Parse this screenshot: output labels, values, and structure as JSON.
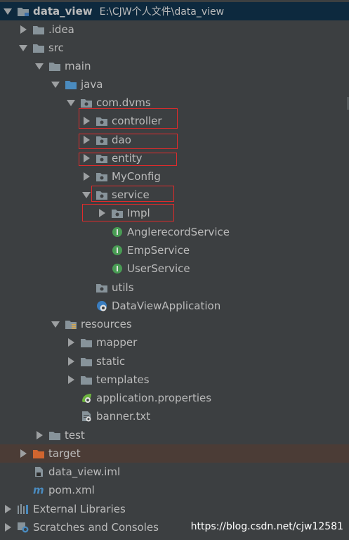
{
  "project": {
    "name": "data_view",
    "path": "E:\\CJW个人文件\\data_view"
  },
  "nodes": {
    "idea": ".idea",
    "src": "src",
    "main": "main",
    "java": "java",
    "package": "com.dvms",
    "controller": "controller",
    "dao": "dao",
    "entity": "entity",
    "myconfig": "MyConfig",
    "service": "service",
    "impl": "Impl",
    "angler": "AnglerecordService",
    "emp": "EmpService",
    "user": "UserService",
    "utils": "utils",
    "app": "DataViewApplication",
    "resources": "resources",
    "mapper": "mapper",
    "static": "static",
    "templates": "templates",
    "appprops": "application.properties",
    "banner": "banner.txt",
    "test": "test",
    "target": "target",
    "iml": "data_view.iml",
    "pom": "pom.xml",
    "extlib": "External Libraries",
    "scratches": "Scratches and Consoles"
  },
  "watermark": "https://blog.csdn.net/cjw12581",
  "colors": {
    "background": "#3c3f41",
    "selection": "#0d293e",
    "target_row": "#4b3c36",
    "annotation_box": "#e02b2b",
    "interface_icon": "#499c54",
    "target_folder": "#d0652f",
    "java_folder": "#4a8bbf"
  }
}
